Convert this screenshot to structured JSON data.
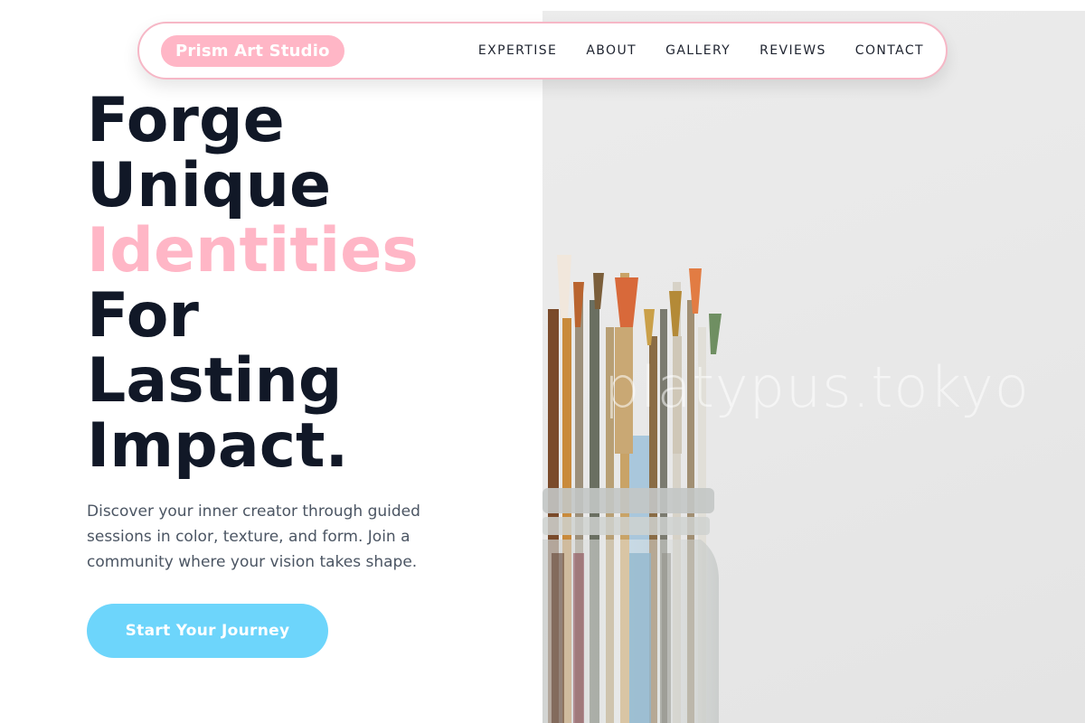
{
  "nav": {
    "brand": "Prism Art Studio",
    "links": [
      "EXPERTISE",
      "ABOUT",
      "GALLERY",
      "REVIEWS",
      "CONTACT"
    ]
  },
  "hero": {
    "headline": {
      "line1": "Forge",
      "line2": "Unique",
      "line3_accent": "Identities",
      "line4": "For",
      "line5": "Lasting",
      "line6": "Impact."
    },
    "description": "Discover your inner creator through guided sessions in color, texture, and form. Join a community where your vision takes shape.",
    "cta_label": "Start Your Journey",
    "image_watermark": "platypus.tokyo",
    "image_subject": "paintbrushes-in-glass-jar"
  },
  "colors": {
    "accent_pink": "#ffb6c6",
    "cta_blue": "#6dd5fb",
    "heading_dark": "#111827",
    "body_gray": "#4b5563"
  }
}
